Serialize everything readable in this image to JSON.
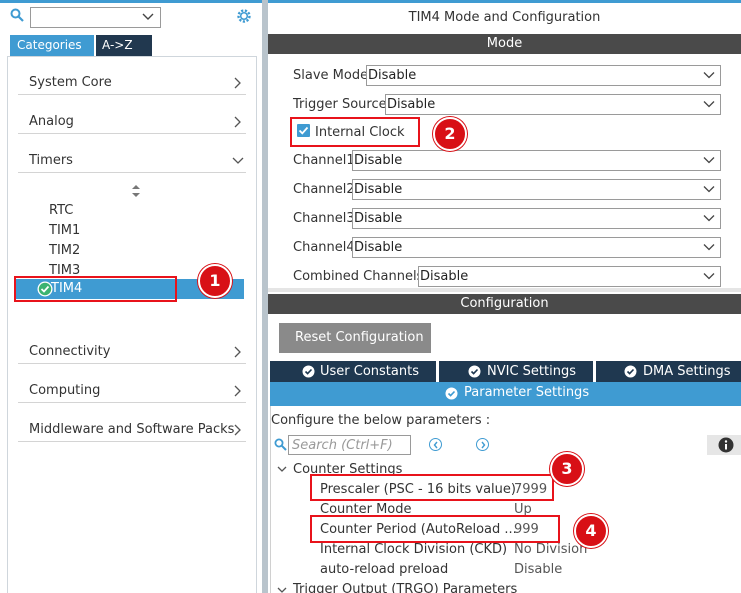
{
  "left": {
    "tabs": {
      "categories": "Categories",
      "az": "A->Z"
    },
    "categories": [
      {
        "label": "System Core"
      },
      {
        "label": "Analog"
      },
      {
        "label": "Timers"
      },
      {
        "label": "Connectivity"
      },
      {
        "label": "Computing"
      },
      {
        "label": "Middleware and Software Packs"
      }
    ],
    "timers": [
      "RTC",
      "TIM1",
      "TIM2",
      "TIM3"
    ],
    "selected_timer": "TIM4"
  },
  "right": {
    "title": "TIM4 Mode and Configuration",
    "mode_header": "Mode",
    "mode_fields": [
      {
        "label": "Slave Mode",
        "value": "Disable"
      },
      {
        "label": "Trigger Source",
        "value": "Disable"
      },
      {
        "label": "Channel1",
        "value": "Disable"
      },
      {
        "label": "Channel2",
        "value": "Disable"
      },
      {
        "label": "Channel3",
        "value": "Disable"
      },
      {
        "label": "Channel4",
        "value": "Disable"
      },
      {
        "label": "Combined Channels",
        "value": "Disable"
      }
    ],
    "internal_clock": {
      "label": "Internal Clock",
      "checked": true
    },
    "config_header": "Configuration",
    "reset_button": "Reset Configuration",
    "tabs": {
      "user_constants": "User Constants",
      "nvic": "NVIC Settings",
      "dma": "DMA Settings",
      "parameter": "Parameter Settings"
    },
    "configure_text": "Configure the below parameters :",
    "search_placeholder": "Search (Ctrl+F)",
    "counter_settings": "Counter Settings",
    "params": [
      {
        "name": "Prescaler (PSC - 16 bits value)",
        "value": "7999"
      },
      {
        "name": "Counter Mode",
        "value": "Up"
      },
      {
        "name": "Counter Period (AutoReload ...",
        "value": "999"
      },
      {
        "name": "Internal Clock Division (CKD)",
        "value": "No Division"
      },
      {
        "name": "auto-reload preload",
        "value": "Disable"
      }
    ],
    "trigger_output": "Trigger Output (TRGO) Parameters"
  },
  "annotations": [
    "1",
    "2",
    "3",
    "4"
  ],
  "colors": {
    "accent": "#3f9bd2",
    "dark_tab": "#1f3850",
    "header": "#4a4a4a",
    "annotation": "#e8131b"
  }
}
